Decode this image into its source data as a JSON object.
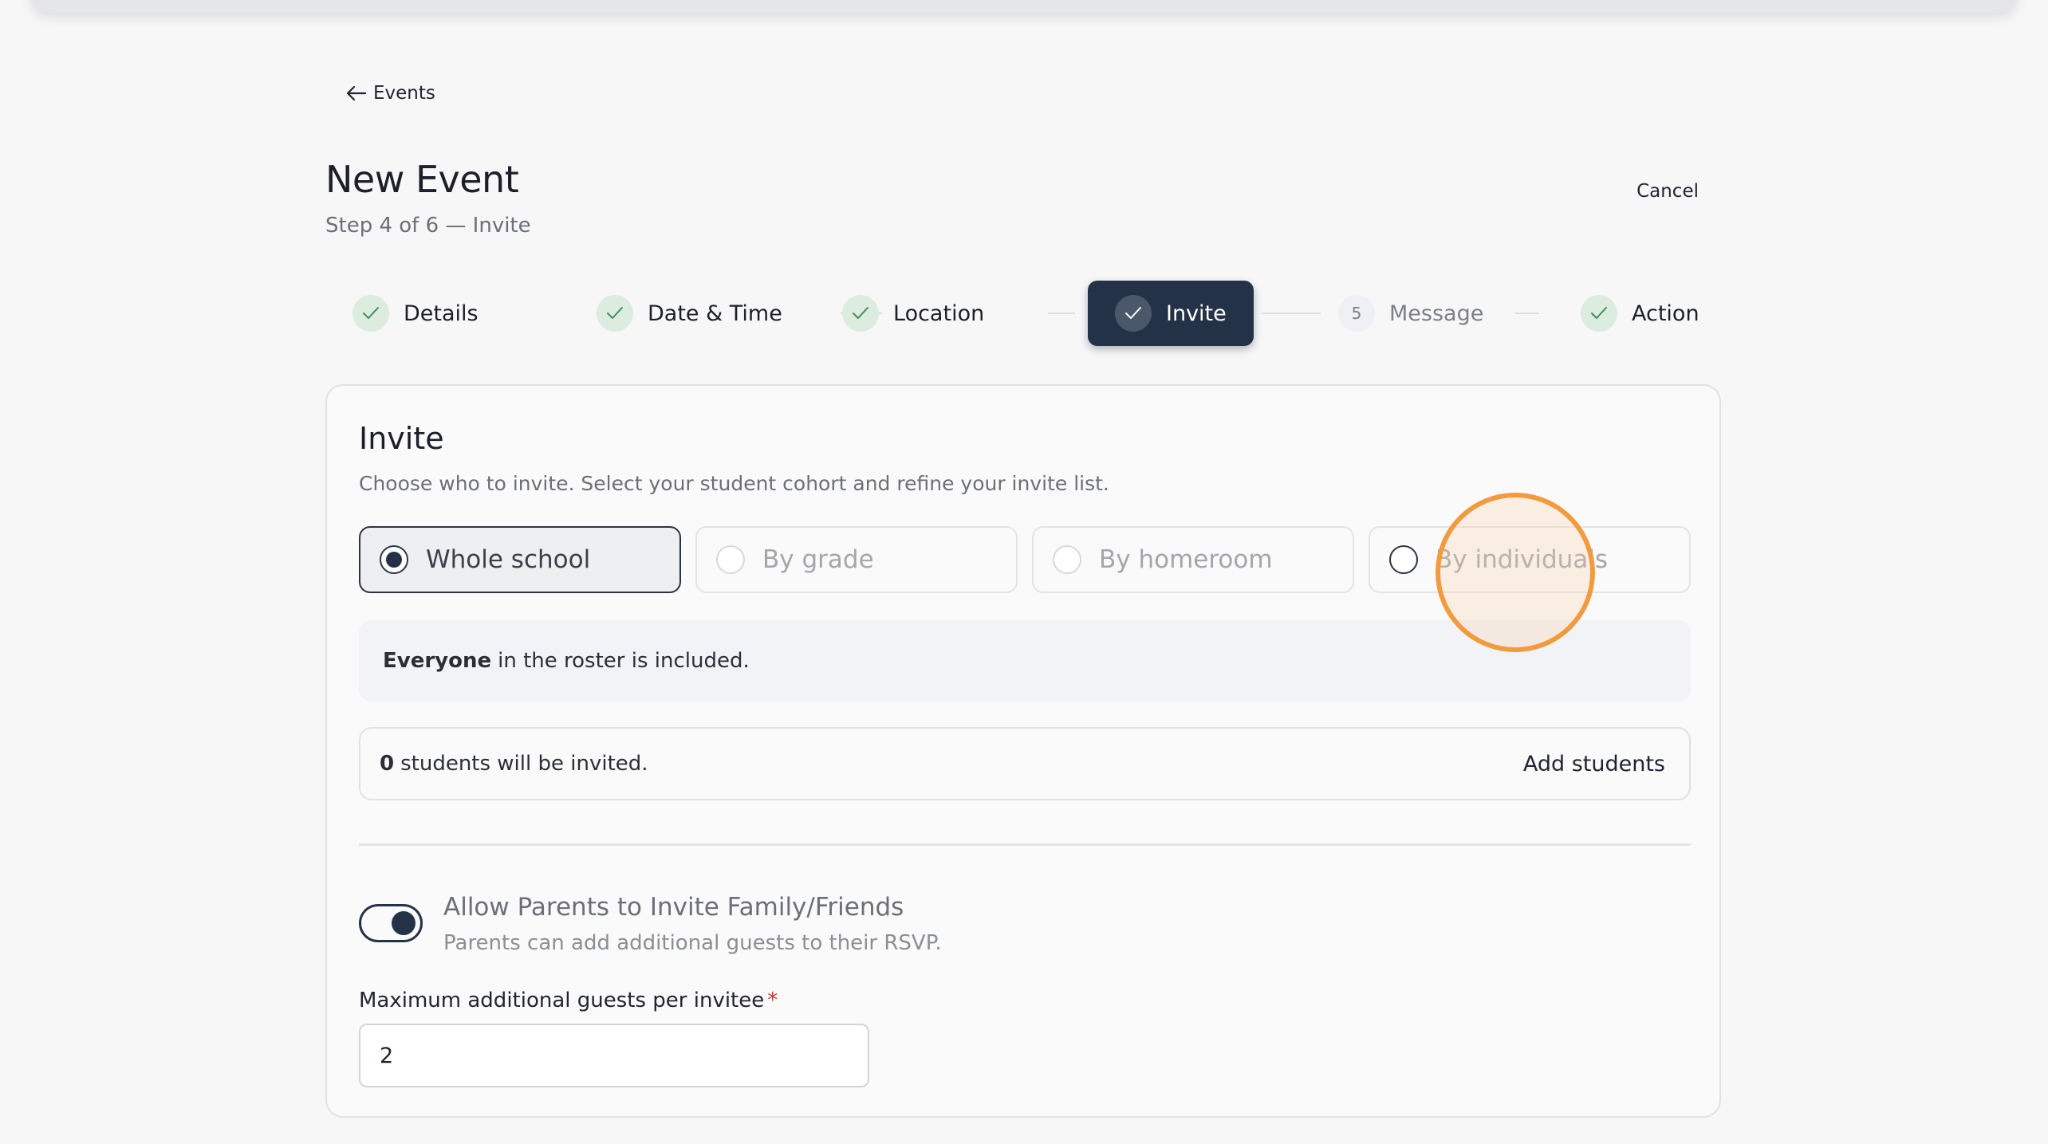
{
  "nav": {
    "back_label": "Events"
  },
  "header": {
    "title": "New Event",
    "subtitle": "Step 4 of 6 — Invite",
    "cancel_label": "Cancel"
  },
  "stepper": {
    "steps": [
      {
        "label": "Details",
        "status": "complete"
      },
      {
        "label": "Date & Time",
        "status": "complete"
      },
      {
        "label": "Location",
        "status": "complete"
      },
      {
        "label": "Invite",
        "status": "active"
      },
      {
        "label": "Message",
        "status": "pending",
        "number": "5"
      },
      {
        "label": "Action",
        "status": "complete"
      }
    ]
  },
  "invite": {
    "title": "Invite",
    "description": "Choose who to invite. Select your student cohort and refine your invite list.",
    "options": [
      {
        "label": "Whole school",
        "selected": true
      },
      {
        "label": "By grade",
        "selected": false
      },
      {
        "label": "By homeroom",
        "selected": false
      },
      {
        "label": "By individuals",
        "selected": false
      }
    ],
    "info_bold": "Everyone",
    "info_rest": "in the roster is included.",
    "count_value": "0",
    "count_text": "students will be invited.",
    "add_students_label": "Add students"
  },
  "guests": {
    "toggle_on": true,
    "toggle_title": "Allow Parents to Invite Family/Friends",
    "toggle_desc": "Parents can add additional guests to their RSVP.",
    "max_label": "Maximum additional guests per invitee",
    "required_mark": "*",
    "max_value": "2"
  },
  "colors": {
    "accent": "#243247",
    "complete_badge": "#dcecdf",
    "click_indicator": "#f29a3e"
  }
}
